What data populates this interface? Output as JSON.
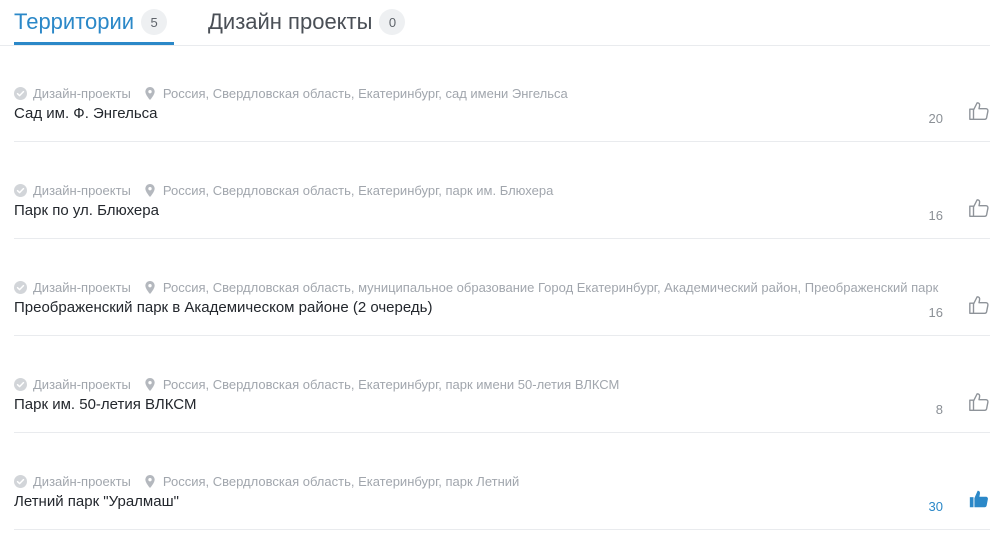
{
  "tabs": [
    {
      "label": "Территории",
      "count": "5",
      "active": true
    },
    {
      "label": "Дизайн проекты",
      "count": "0",
      "active": false
    }
  ],
  "colors": {
    "accent": "#2b88c8",
    "muted": "#a1a6ad",
    "divider": "#e9ebee"
  },
  "items": [
    {
      "category": "Дизайн-проекты",
      "address": "Россия, Свердловская область, Екатеринбург, сад имени Энгельса",
      "title": "Сад им. Ф. Энгельса",
      "likes": "20",
      "liked": false,
      "icon": "thumbs-up-outline-icon"
    },
    {
      "category": "Дизайн-проекты",
      "address": "Россия, Свердловская область, Екатеринбург, парк им. Блюхера",
      "title": "Парк по ул. Блюхера",
      "likes": "16",
      "liked": false,
      "icon": "thumbs-up-outline-icon"
    },
    {
      "category": "Дизайн-проекты",
      "address": "Россия, Свердловская область, муниципальное образование Город Екатеринбург, Академический район, Преображенский парк",
      "title": "Преображенский парк в Академическом районе (2 очередь)",
      "likes": "16",
      "liked": false,
      "icon": "thumbs-up-outline-icon"
    },
    {
      "category": "Дизайн-проекты",
      "address": "Россия, Свердловская область, Екатеринбург, парк имени 50-летия ВЛКСМ",
      "title": "Парк им. 50-летия ВЛКСМ",
      "likes": "8",
      "liked": false,
      "icon": "thumbs-up-outline-icon"
    },
    {
      "category": "Дизайн-проекты",
      "address": "Россия, Свердловская область, Екатеринбург, парк Летний",
      "title": "Летний парк \"Уралмаш\"",
      "likes": "30",
      "liked": true,
      "icon": "thumbs-up-filled-icon"
    }
  ]
}
